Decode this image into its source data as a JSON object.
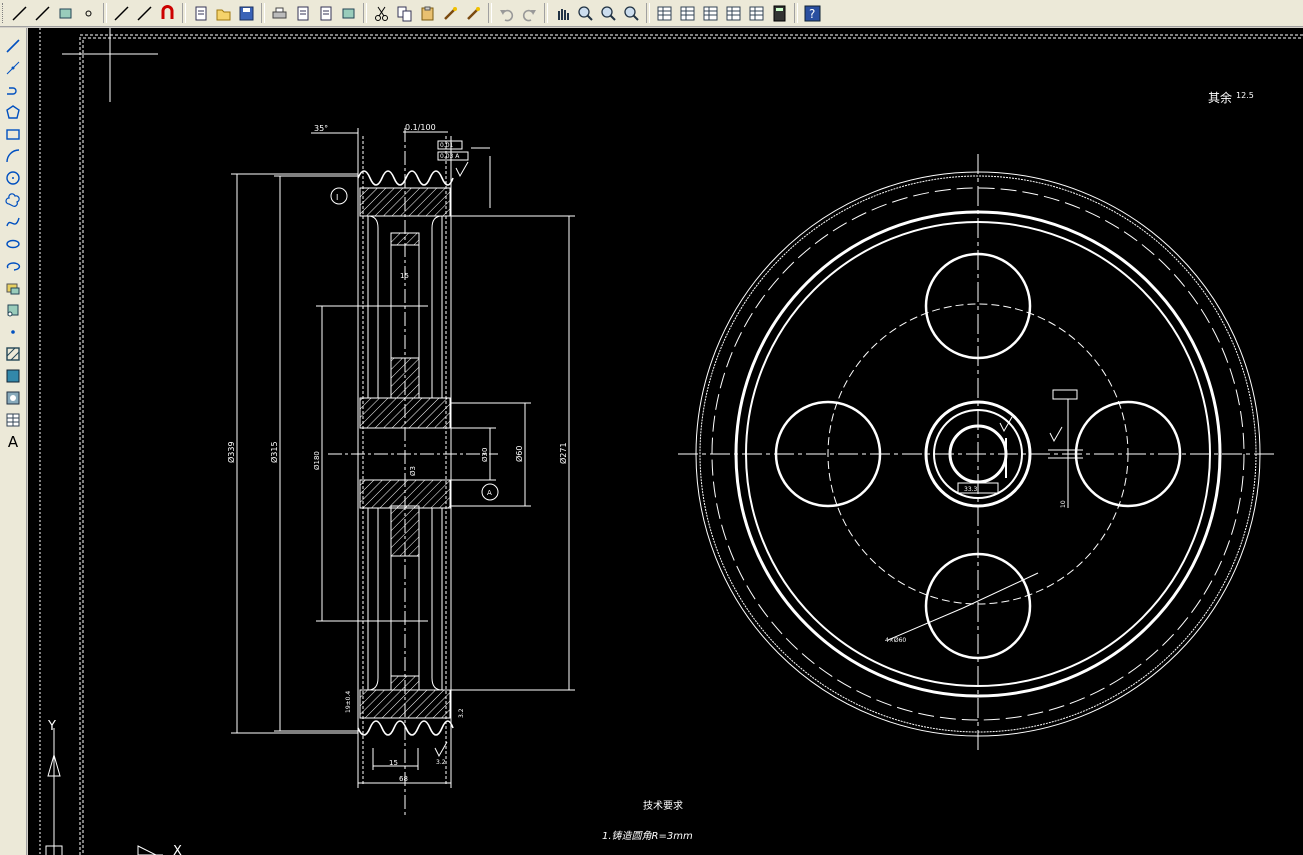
{
  "toolbar": {
    "buttons": [
      {
        "name": "polyline-icon",
        "kind": "line"
      },
      {
        "name": "parallel-lines-icon",
        "kind": "line"
      },
      {
        "name": "block-insert-icon",
        "kind": "shape"
      },
      {
        "name": "point-icon",
        "kind": "dot"
      },
      {
        "sep": true
      },
      {
        "name": "snap-endpoint-icon",
        "kind": "line"
      },
      {
        "name": "snap-nearest-icon",
        "kind": "line"
      },
      {
        "name": "magnet-snap-icon",
        "kind": "magnet"
      },
      {
        "sep": true
      },
      {
        "name": "new-file-icon",
        "kind": "doc"
      },
      {
        "name": "open-file-icon",
        "kind": "folder"
      },
      {
        "name": "save-icon",
        "kind": "disk"
      },
      {
        "sep": true
      },
      {
        "name": "print-icon",
        "kind": "print"
      },
      {
        "name": "print-preview-icon",
        "kind": "doc"
      },
      {
        "name": "publish-icon",
        "kind": "doc"
      },
      {
        "name": "plot-icon",
        "kind": "shape"
      },
      {
        "sep": true
      },
      {
        "name": "cut-icon",
        "kind": "cut"
      },
      {
        "name": "copy-icon",
        "kind": "copy"
      },
      {
        "name": "paste-icon",
        "kind": "paste"
      },
      {
        "name": "match-properties-icon",
        "kind": "brush"
      },
      {
        "name": "block-editor-icon",
        "kind": "brush"
      },
      {
        "sep": true
      },
      {
        "name": "undo-icon",
        "kind": "undo"
      },
      {
        "name": "redo-icon",
        "kind": "redo"
      },
      {
        "sep": true
      },
      {
        "name": "pan-icon",
        "kind": "hand"
      },
      {
        "name": "zoom-realtime-icon",
        "kind": "zoom"
      },
      {
        "name": "zoom-window-icon",
        "kind": "zoom"
      },
      {
        "name": "zoom-previous-icon",
        "kind": "zoom"
      },
      {
        "sep": true
      },
      {
        "name": "properties-icon",
        "kind": "grid"
      },
      {
        "name": "design-center-icon",
        "kind": "grid"
      },
      {
        "name": "tool-palettes-icon",
        "kind": "grid"
      },
      {
        "name": "sheet-set-icon",
        "kind": "grid"
      },
      {
        "name": "markup-icon",
        "kind": "grid"
      },
      {
        "name": "calculator-icon",
        "kind": "calc"
      },
      {
        "sep": true
      },
      {
        "name": "help-icon",
        "kind": "help"
      }
    ]
  },
  "left_toolbar": {
    "buttons": [
      "line-icon",
      "construction-line-icon",
      "polyline-icon",
      "polygon-icon",
      "rectangle-icon",
      "arc-icon",
      "circle-icon",
      "revision-cloud-icon",
      "spline-icon",
      "ellipse-icon",
      "ellipse-arc-icon",
      "insert-block-icon",
      "make-block-icon",
      "point-icon",
      "hatch-icon",
      "gradient-icon",
      "region-icon",
      "table-icon",
      "multiline-text-icon"
    ],
    "text_tool_label": "A"
  },
  "drawing": {
    "surface_note": "其余",
    "surface_roughness": "12.5",
    "tech_req_title": "技术要求",
    "tech_req_line1": "1.铸造圆角R=3mm",
    "ucs_y": "Y",
    "ucs_x": "X",
    "dim_top_1": "35°",
    "dim_top_2": "0.1/100",
    "dim_gtol_1": "0.01",
    "dim_gtol_2": "0.03 A",
    "dim_d_outer": "Ø339",
    "dim_d_pitch": "Ø315",
    "dim_d_inner": "Ø180",
    "dim_d_hub": "Ø60",
    "dim_d_bore": "Ø30",
    "dim_d_rim": "Ø271",
    "dim_w_web": "15",
    "dim_w_groove": "Ø3",
    "dim_bottom_1": "15",
    "dim_bottom_2": "68",
    "dim_groove_pitch": "19±0.4",
    "dim_groove_depth": "3.2",
    "dim_keyway": "33.3",
    "dim_keyway_w": "10",
    "dim_4x": "4×Ø60",
    "dim_datum": "A",
    "dim_detail": "I",
    "dim_rough_top": "3.2"
  }
}
